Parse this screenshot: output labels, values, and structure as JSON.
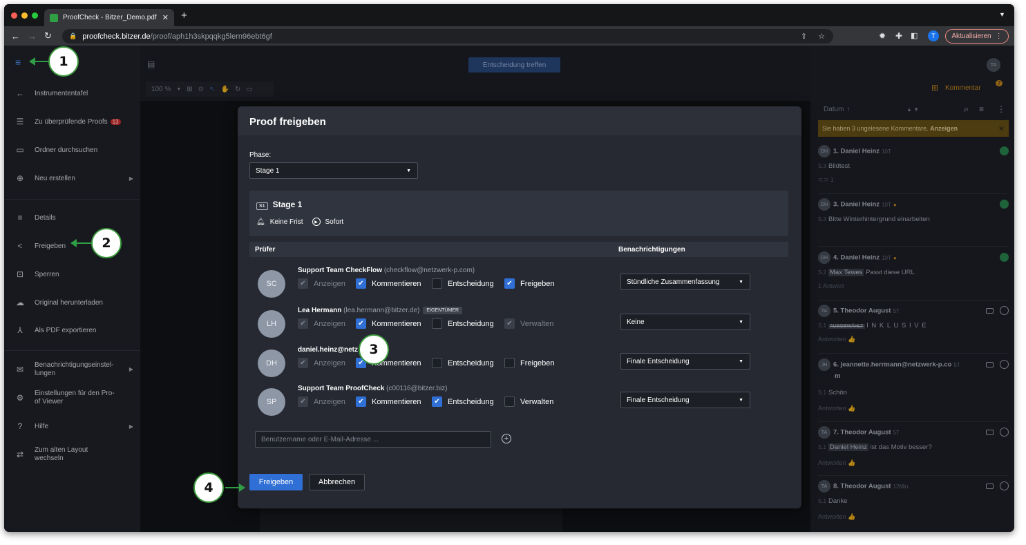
{
  "browser": {
    "tab_title": "ProofCheck - Bitzer_Demo.pdf",
    "url_host": "proofcheck.bitzer.de",
    "url_path": "/proof/aph1h3skpqqkg5lern96ebt6gf",
    "update_label": "Aktualisieren",
    "profile_initial": "T"
  },
  "sidebar": {
    "items": [
      {
        "label": "Instrumententafel"
      },
      {
        "label": "Zu überprüfende Proofs",
        "badge": "13"
      },
      {
        "label": "Ordner durchsuchen"
      },
      {
        "label": "Neu erstellen"
      },
      {
        "label": "Details"
      },
      {
        "label": "Freigeben"
      },
      {
        "label": "Sperren"
      },
      {
        "label": "Original herunterladen"
      },
      {
        "label": "Als PDF exportieren"
      },
      {
        "label": "Benachrichtigungseinstel-\nlungen"
      },
      {
        "label": "Einstellungen für den Pro-\nof Viewer"
      },
      {
        "label": "Hilfe"
      },
      {
        "label": "Zum alten Layout\nwechseln"
      }
    ]
  },
  "topbar": {
    "decision_button": "Entscheidung treffen",
    "avatar": "TA",
    "zoom": "100 %"
  },
  "right_panel": {
    "sort_label": "Datum",
    "add_comment": "Kommentar",
    "comment_count": "7",
    "unread_text": "Sie haben 3 ungelesene Kommentare.",
    "unread_link": "Anzeigen",
    "comments": [
      {
        "avatar": "DH",
        "name": "1. Daniel Heinz",
        "meta": "10T",
        "page": "S.3",
        "text": "Bildtest",
        "extra": "1"
      },
      {
        "avatar": "DH",
        "name": "3. Daniel Heinz",
        "meta": "10T",
        "page": "S.3",
        "text": "Bitte Winterhintergrund einarbeiten"
      },
      {
        "avatar": "DH",
        "name": "4. Daniel Heinz",
        "meta": "10T",
        "page": "S.2",
        "mention": "Max Tewes",
        "text": "Passt diese URL",
        "extra": "1 Antwort"
      },
      {
        "avatar": "TA",
        "name": "5. Theodor August",
        "meta": "5T",
        "page": "S.1",
        "mention": "AUSGEWÄHLT",
        "text": "I N K L U S I V E",
        "extra": "Antworten"
      },
      {
        "avatar": "JH",
        "name": "6. jeannette.herrmann@netzwerk-p.co",
        "meta": "5T",
        "text2": "m",
        "page": "S.1",
        "text": "Schön",
        "extra": "Antworten"
      },
      {
        "avatar": "TA",
        "name": "7. Theodor August",
        "meta": "5T",
        "page": "S.1",
        "mention": "Daniel Heinz",
        "text": "ist das Motiv besser?",
        "extra": "Antworten"
      },
      {
        "avatar": "TA",
        "name": "8. Theodor August",
        "meta": "12Min.",
        "page": "S.1",
        "text": "Danke",
        "extra": "Antworten"
      }
    ]
  },
  "dialog": {
    "title": "Proof freigeben",
    "phase_label": "Phase:",
    "phase_value": "Stage 1",
    "stage_tag": "S1",
    "stage_name": "Stage 1",
    "deadline": "Keine Frist",
    "start": "Sofort",
    "col_reviewer": "Prüfer",
    "col_notifications": "Benachrichtigungen",
    "reviewers": [
      {
        "initials": "SC",
        "name": "Support Team CheckFlow",
        "email": "(checkflow@netzwerk-p.com)",
        "owner": "",
        "opt1": "Anzeigen",
        "opt2": "Kommentieren",
        "opt3": "Entscheidung",
        "opt4": "Freigeben",
        "notif": "Stündliche Zusammenfassung"
      },
      {
        "initials": "LH",
        "name": "Lea Hermann",
        "email": "(lea.hermann@bitzer.de)",
        "owner": "EIGENTÜMER",
        "opt1": "Anzeigen",
        "opt2": "Kommentieren",
        "opt3": "Entscheidung",
        "opt4": "Verwalten",
        "notif": "Keine"
      },
      {
        "initials": "DH",
        "name": "daniel.heinz@netz",
        "email": "",
        "owner": "",
        "opt1": "Anzeigen",
        "opt2": "Kommentieren",
        "opt3": "Entscheidung",
        "opt4": "Freigeben",
        "notif": "Finale Entscheidung"
      },
      {
        "initials": "SP",
        "name": "Support Team ProofCheck",
        "email": "(c00116@bitzer.biz)",
        "owner": "",
        "opt1": "Anzeigen",
        "opt2": "Kommentieren",
        "opt3": "Entscheidung",
        "opt4": "Verwalten",
        "notif": "Finale Entscheidung"
      }
    ],
    "input_placeholder": "Benutzername oder E-Mail-Adresse ...",
    "submit": "Freigeben",
    "cancel": "Abbrechen"
  },
  "callouts": [
    "1",
    "2",
    "3",
    "4"
  ],
  "colors": {
    "accent": "#2f6fd6",
    "callout_green": "#2f9e44"
  }
}
